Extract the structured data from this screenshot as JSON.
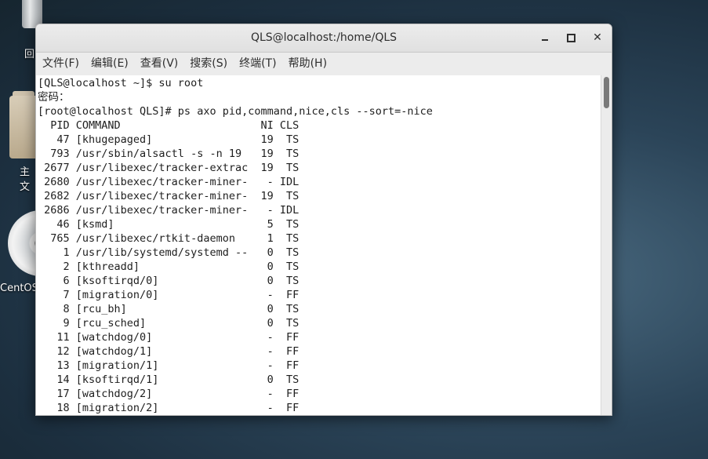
{
  "desktop": {
    "trash_label": "回",
    "home_label": "主文",
    "disc_label": "CentOS"
  },
  "window": {
    "title": "QLS@localhost:/home/QLS",
    "minimize_label": "",
    "maximize_label": "",
    "close_label": "✕"
  },
  "menu": {
    "items": [
      {
        "label": "文件(F)"
      },
      {
        "label": "编辑(E)"
      },
      {
        "label": "查看(V)"
      },
      {
        "label": "搜索(S)"
      },
      {
        "label": "终端(T)"
      },
      {
        "label": "帮助(H)"
      }
    ]
  },
  "terminal": {
    "lines": [
      "[QLS@localhost ~]$ su root",
      "密码：",
      "[root@localhost QLS]# ps axo pid,command,nice,cls --sort=-nice",
      "  PID COMMAND                      NI CLS",
      "   47 [khugepaged]                 19  TS",
      "  793 /usr/sbin/alsactl -s -n 19   19  TS",
      " 2677 /usr/libexec/tracker-extrac  19  TS",
      " 2680 /usr/libexec/tracker-miner-   - IDL",
      " 2682 /usr/libexec/tracker-miner-  19  TS",
      " 2686 /usr/libexec/tracker-miner-   - IDL",
      "   46 [ksmd]                        5  TS",
      "  765 /usr/libexec/rtkit-daemon     1  TS",
      "    1 /usr/lib/systemd/systemd --   0  TS",
      "    2 [kthreadd]                    0  TS",
      "    6 [ksoftirqd/0]                 0  TS",
      "    7 [migration/0]                 -  FF",
      "    8 [rcu_bh]                      0  TS",
      "    9 [rcu_sched]                   0  TS",
      "   11 [watchdog/0]                  -  FF",
      "   12 [watchdog/1]                  -  FF",
      "   13 [migration/1]                 -  FF",
      "   14 [ksoftirqd/1]                 0  TS",
      "   17 [watchdog/2]                  -  FF",
      "   18 [migration/2]                 -  FF"
    ]
  }
}
